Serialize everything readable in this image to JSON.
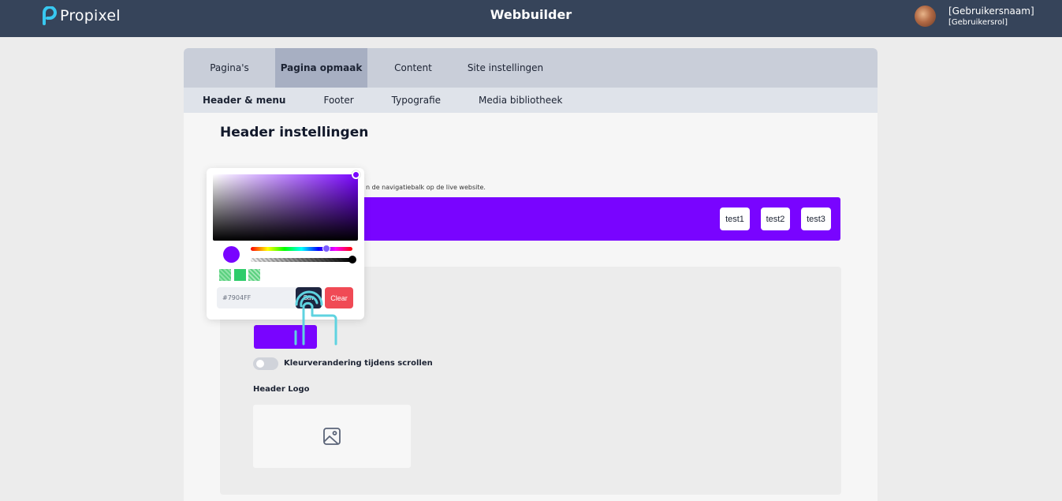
{
  "topbar": {
    "brand": "Propixel",
    "app_title": "Webbuilder",
    "user_name": "[Gebruikersnaam]",
    "user_role": "[Gebruikersrol]"
  },
  "tabs": [
    {
      "label": "Pagina's",
      "active": false
    },
    {
      "label": "Pagina opmaak",
      "active": true
    },
    {
      "label": "Content",
      "active": false
    },
    {
      "label": "Site instellingen",
      "active": false
    }
  ],
  "subtabs": [
    {
      "label": "Header & menu",
      "active": true
    },
    {
      "label": "Footer",
      "active": false
    },
    {
      "label": "Typografie",
      "active": false
    },
    {
      "label": "Media bibliotheek",
      "active": false
    }
  ],
  "main": {
    "title": "Header instellingen",
    "hint": "n de navigatiebalk op de live website.",
    "preview_nav": [
      "test1",
      "test2",
      "test3"
    ],
    "toggle_label": "Kleurverandering tijdens scrollen",
    "toggle_on": false,
    "logo_label": "Header Logo"
  },
  "picker": {
    "hex_value": "#7904FF",
    "save_label": "Sav",
    "clear_label": "Clear"
  },
  "colors": {
    "topbar": "#36445a",
    "accent": "#7904ff",
    "clear": "#f04a55",
    "cursor": "#5fd3e0"
  }
}
